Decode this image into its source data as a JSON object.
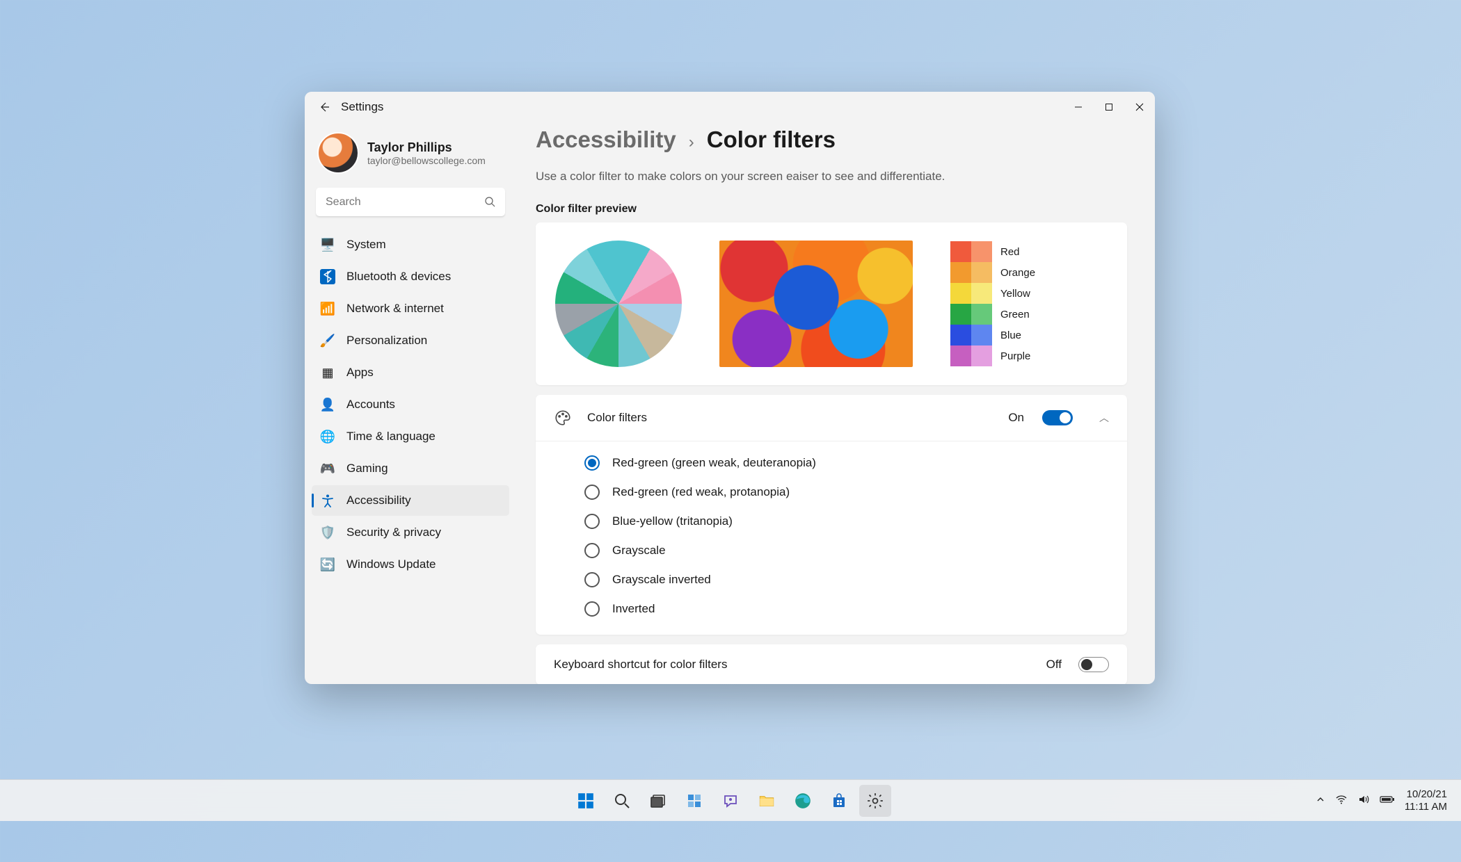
{
  "app_title": "Settings",
  "user": {
    "name": "Taylor Phillips",
    "email": "taylor@bellowscollege.com"
  },
  "search": {
    "placeholder": "Search"
  },
  "nav": [
    {
      "label": "System",
      "icon": "🖥️"
    },
    {
      "label": "Bluetooth & devices",
      "icon": "bluetooth"
    },
    {
      "label": "Network & internet",
      "icon": "📶"
    },
    {
      "label": "Personalization",
      "icon": "🖌️"
    },
    {
      "label": "Apps",
      "icon": "▦"
    },
    {
      "label": "Accounts",
      "icon": "👤"
    },
    {
      "label": "Time & language",
      "icon": "🌐"
    },
    {
      "label": "Gaming",
      "icon": "🎮"
    },
    {
      "label": "Accessibility",
      "icon": "accessibility",
      "active": true
    },
    {
      "label": "Security & privacy",
      "icon": "🛡️"
    },
    {
      "label": "Windows Update",
      "icon": "🔄"
    }
  ],
  "breadcrumb": {
    "parent": "Accessibility",
    "sep": "›",
    "current": "Color filters"
  },
  "description": "Use a color filter to make colors on your screen eaiser to see and differentiate.",
  "preview": {
    "label": "Color filter preview",
    "swatches": [
      {
        "label": "Red",
        "colors": [
          "#f05a3c",
          "#f7936b"
        ]
      },
      {
        "label": "Orange",
        "colors": [
          "#f29a2e",
          "#f5bc62"
        ]
      },
      {
        "label": "Yellow",
        "colors": [
          "#f4d83a",
          "#f7e97a"
        ]
      },
      {
        "label": "Green",
        "colors": [
          "#27a644",
          "#66c97a"
        ]
      },
      {
        "label": "Blue",
        "colors": [
          "#2a4de0",
          "#5e86f0"
        ]
      },
      {
        "label": "Purple",
        "colors": [
          "#c65fc0",
          "#e49fe0"
        ]
      }
    ]
  },
  "color_filters": {
    "title": "Color filters",
    "status": "On",
    "enabled": true,
    "options": [
      "Red-green (green weak, deuteranopia)",
      "Red-green (red weak, protanopia)",
      "Blue-yellow (tritanopia)",
      "Grayscale",
      "Grayscale inverted",
      "Inverted"
    ],
    "selected_index": 0
  },
  "shortcut": {
    "title": "Keyboard shortcut for color filters",
    "status": "Off",
    "enabled": false
  },
  "taskbar": {
    "date": "10/20/21",
    "time": "11:11 AM"
  }
}
